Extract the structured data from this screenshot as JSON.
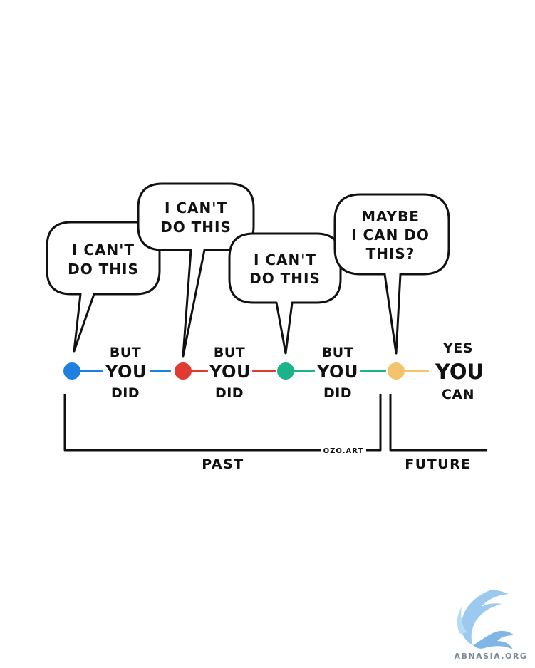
{
  "bubbles": [
    {
      "line1": "I CAN'T",
      "line2": "DO THIS",
      "line3": ""
    },
    {
      "line1": "I CAN'T",
      "line2": "DO THIS",
      "line3": ""
    },
    {
      "line1": "I CAN'T",
      "line2": "DO THIS",
      "line3": ""
    },
    {
      "line1": "MAYBE",
      "line2": "I CAN DO",
      "line3": "THIS?"
    }
  ],
  "steps": [
    {
      "top": "BUT",
      "middle": "YOU",
      "bottom": "DID"
    },
    {
      "top": "BUT",
      "middle": "YOU",
      "bottom": "DID"
    },
    {
      "top": "BUT",
      "middle": "YOU",
      "bottom": "DID"
    }
  ],
  "final_step": {
    "top": "YES",
    "middle": "YOU",
    "bottom": "CAN"
  },
  "labels": {
    "past": "PAST",
    "future": "FUTURE",
    "signature": "OZO.ART"
  },
  "watermark": {
    "text": "ABNASIA.ORG",
    "logo": "bird-logo-icon"
  },
  "colors": {
    "dot1": "#1f7fe0",
    "dot2": "#e03a32",
    "dot3": "#1ab38a",
    "dot4": "#f5c36b",
    "line": "#111111"
  }
}
